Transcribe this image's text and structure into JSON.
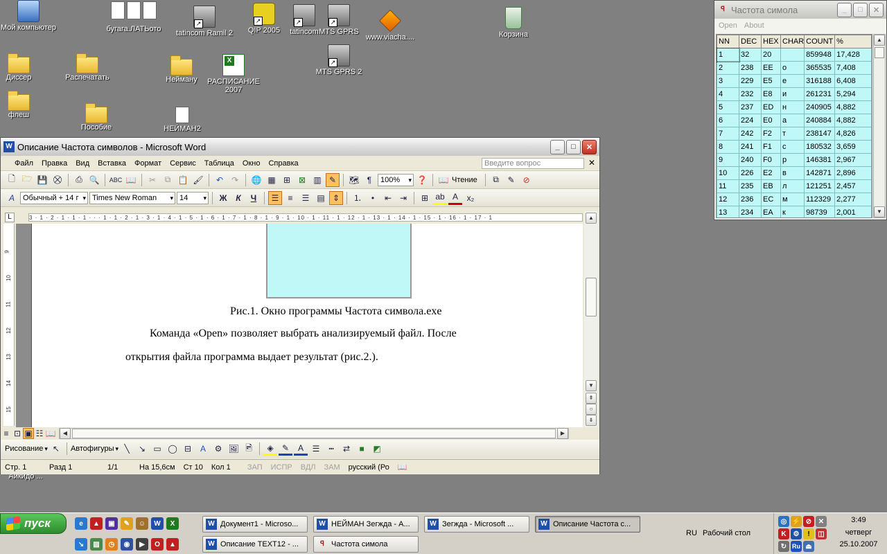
{
  "desktop": {
    "icons": [
      {
        "label": "Мой компьютер",
        "type": "pc"
      },
      {
        "label": "бугага.ЛАТЬото",
        "type": "docs"
      },
      {
        "label": "tatincom Ramil 2",
        "type": "net"
      },
      {
        "label": "QIP 2005",
        "type": "qip"
      },
      {
        "label": "tatincom",
        "type": "net"
      },
      {
        "label": "MTS GPRS",
        "type": "net"
      },
      {
        "label": "www.viacha....",
        "type": "bolt"
      },
      {
        "label": "Корзина",
        "type": "recycle"
      },
      {
        "label": "Диссер",
        "type": "folder"
      },
      {
        "label": "Распечатать",
        "type": "folder"
      },
      {
        "label": "Нейману",
        "type": "folder"
      },
      {
        "label": "РАСПИСАНИЕ 2007",
        "type": "excel"
      },
      {
        "label": "MTS GPRS 2",
        "type": "net"
      },
      {
        "label": "флеш",
        "type": "folder"
      },
      {
        "label": "Пособие",
        "type": "folder"
      },
      {
        "label": "НЕЙМАН2",
        "type": "docs"
      },
      {
        "label": "Аикидо ...",
        "type": "folder"
      }
    ]
  },
  "freq_window": {
    "title": "Частота симола",
    "title_icon": "app-icon",
    "menu": [
      "Open",
      "About"
    ],
    "columns": [
      "NN",
      "DEC",
      "HEX",
      "CHAR",
      "COUNT",
      "%"
    ],
    "rows": [
      [
        "1",
        "32",
        "20",
        "",
        "859948",
        "17,428"
      ],
      [
        "2",
        "238",
        "EE",
        "о",
        "365535",
        "7,408"
      ],
      [
        "3",
        "229",
        "E5",
        "е",
        "316188",
        "6,408"
      ],
      [
        "4",
        "232",
        "E8",
        "и",
        "261231",
        "5,294"
      ],
      [
        "5",
        "237",
        "ED",
        "н",
        "240905",
        "4,882"
      ],
      [
        "6",
        "224",
        "E0",
        "а",
        "240884",
        "4,882"
      ],
      [
        "7",
        "242",
        "F2",
        "т",
        "238147",
        "4,826"
      ],
      [
        "8",
        "241",
        "F1",
        "с",
        "180532",
        "3,659"
      ],
      [
        "9",
        "240",
        "F0",
        "р",
        "146381",
        "2,967"
      ],
      [
        "10",
        "226",
        "E2",
        "в",
        "142871",
        "2,896"
      ],
      [
        "11",
        "235",
        "EB",
        "л",
        "121251",
        "2,457"
      ],
      [
        "12",
        "236",
        "EC",
        "м",
        "112329",
        "2,277"
      ],
      [
        "13",
        "234",
        "EA",
        "к",
        "98739",
        "2,001"
      ]
    ]
  },
  "word": {
    "title": "Описание Частота символов - Microsoft Word",
    "menu": [
      "Файл",
      "Правка",
      "Вид",
      "Вставка",
      "Формат",
      "Сервис",
      "Таблица",
      "Окно",
      "Справка"
    ],
    "ask_placeholder": "Введите вопрос",
    "zoom": "100%",
    "reading_label": "Чтение",
    "style": "Обычный + 14 г",
    "font": "Times New Roman",
    "font_size": "14",
    "bold": "Ж",
    "italic": "К",
    "underline": "Ч",
    "ruler": "3 · 1 · 2 · 1 · 1 · 1 · · · 1 · 1 · 2 · 1 · 3 · 1 · 4 · 1 · 5 · 1 · 6 · 1 · 7 · 1 · 8 · 1 · 9 · 1 · 10 · 1 · 11 · 1 · 12 · 1 · 13 · 1 · 14 · 1 · 15 · 1 · 16 · 1 · 17 · 1",
    "vruler_marks": [
      "9",
      "10",
      "11",
      "12",
      "13",
      "14",
      "15"
    ],
    "caption": "Рис.1. Окно программы Частота символа.exe",
    "para_line1": "Команда «Open» позволяет выбрать анализируемый файл. После",
    "para_line2": "открытия файла программа выдает результат (рис.2.).",
    "draw_label": "Рисование",
    "autoshapes_label": "Автофигуры",
    "status": {
      "page": "Стр. 1",
      "section": "Разд 1",
      "pages": "1/1",
      "at": "На 15,6см",
      "line": "Ст 10",
      "col": "Кол 1",
      "rec": "ЗАП",
      "trk": "ИСПР",
      "ext": "ВДЛ",
      "ovr": "ЗАМ",
      "lang": "русский (Ро"
    }
  },
  "taskbar": {
    "start_label": "пуск",
    "tasks_row1": [
      "Документ1 - Microso...",
      "НЕЙМАН Зегжда - А...",
      "Зегжда - Microsoft ...",
      "Описание Частота с..."
    ],
    "tasks_row2": [
      "Описание TEXT12 - ...",
      "Частота симола"
    ],
    "lang": "RU",
    "desktop_label": "Рабочий стол",
    "time": "3:49",
    "day": "четверг",
    "date": "25.10.2007"
  }
}
